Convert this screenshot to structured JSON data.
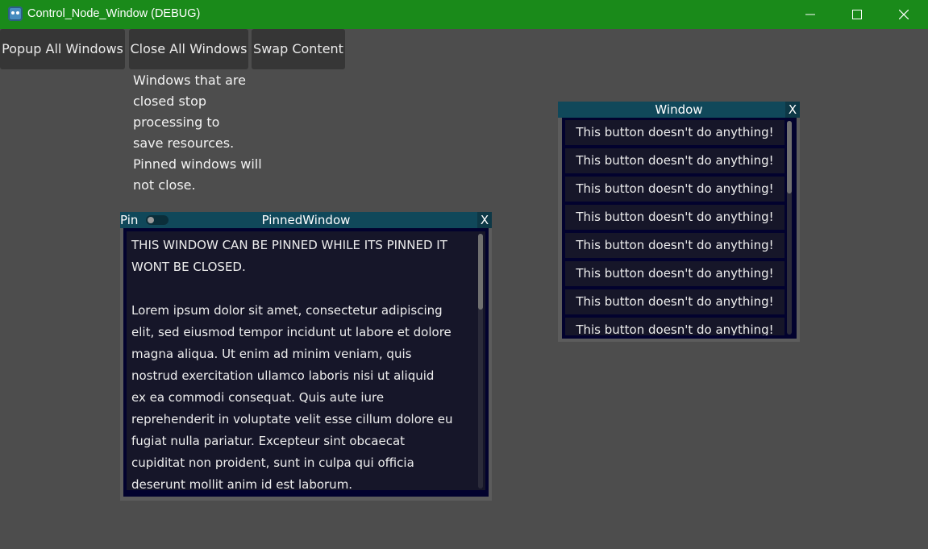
{
  "window": {
    "title": "Control_Node_Window (DEBUG)",
    "title_bar_color": "#1a8a1a",
    "icon": "godot-icon",
    "controls": [
      "minimize-icon",
      "maximize-icon",
      "close-icon"
    ]
  },
  "toolbar": {
    "popup_all": "Popup All Windows",
    "close_all": "Close All Windows",
    "swap_content": "Swap Content"
  },
  "info_text": "Windows that are\nclosed stop\nprocessing to\nsave resources.\nPinned windows will\nnot close.",
  "pinned_window": {
    "pin_label": "Pin",
    "pin_toggled": false,
    "title": "PinnedWindow",
    "close_label": "X",
    "body": "THIS WINDOW CAN BE PINNED WHILE ITS PINNED IT\nWONT BE CLOSED.\n\nLorem ipsum dolor sit amet, consectetur adipiscing\nelit, sed eiusmod tempor incidunt ut labore et dolore\nmagna aliqua. Ut enim ad minim veniam, quis\nnostrud exercitation ullamco laboris nisi ut aliquid\nex ea commodi consequat. Quis aute iure\nreprehenderit in voluptate velit esse cillum dolore eu\nfugiat nulla pariatur. Excepteur sint obcaecat\ncupiditat non proident, sunt in culpa qui officia\ndeserunt mollit anim id est laborum."
  },
  "list_window": {
    "title": "Window",
    "close_label": "X",
    "buttons": [
      "This button doesn't do anything!",
      "This button doesn't do anything!",
      "This button doesn't do anything!",
      "This button doesn't do anything!",
      "This button doesn't do anything!",
      "This button doesn't do anything!",
      "This button doesn't do anything!",
      "This button doesn't do anything!"
    ]
  }
}
